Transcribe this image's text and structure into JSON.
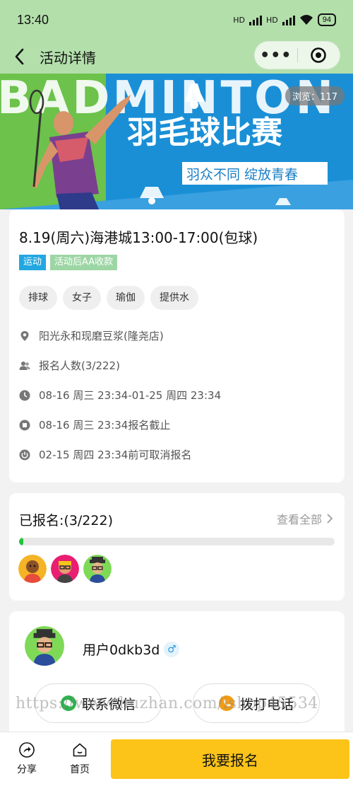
{
  "status_bar": {
    "time": "13:40",
    "network_label": "HD",
    "battery": "94"
  },
  "nav": {
    "title": "活动详情"
  },
  "banner": {
    "bg_text": "BADMINTON",
    "title": "羽毛球比赛",
    "subtitle": "羽众不同  绽放青春",
    "views_label": "浏览：117"
  },
  "event": {
    "title": "8.19(周六)海港城13:00-17:00(包球)",
    "tags": [
      "运动",
      "活动后AA收款"
    ],
    "chips": [
      "排球",
      "女子",
      "瑜伽",
      "提供水"
    ],
    "location": "阳光永和现磨豆浆(隆尧店)",
    "participants": "报名人数(3/222)",
    "time_range": "08-16 周三 23:34-01-25 周四 23:34",
    "signup_deadline": "08-16 周三 23:34报名截止",
    "cancel_deadline": "02-15 周四 23:34前可取消报名"
  },
  "signup": {
    "title": "已报名:(3/222)",
    "view_all": "查看全部",
    "progress": 0.0135,
    "avatars": [
      "avatar-orange",
      "avatar-pink",
      "avatar-green"
    ]
  },
  "organizer": {
    "name": "用户0dkb3d",
    "gender_symbol": "♂",
    "wechat_label": "联系微信",
    "phone_label": "拨打电话"
  },
  "watermark": "https://www.huzhan.com/ishop45534",
  "bottom_bar": {
    "share_label": "分享",
    "home_label": "首页",
    "signup_button": "我要报名"
  },
  "colors": {
    "header_bg": "#b3dfab",
    "accent_yellow": "#fcc419",
    "tag_blue": "#22a7e0",
    "tag_green": "#9dd6a5",
    "progress_green": "#22c43a",
    "banner_blue": "#1a8fd6",
    "banner_green": "#6cc24a"
  }
}
